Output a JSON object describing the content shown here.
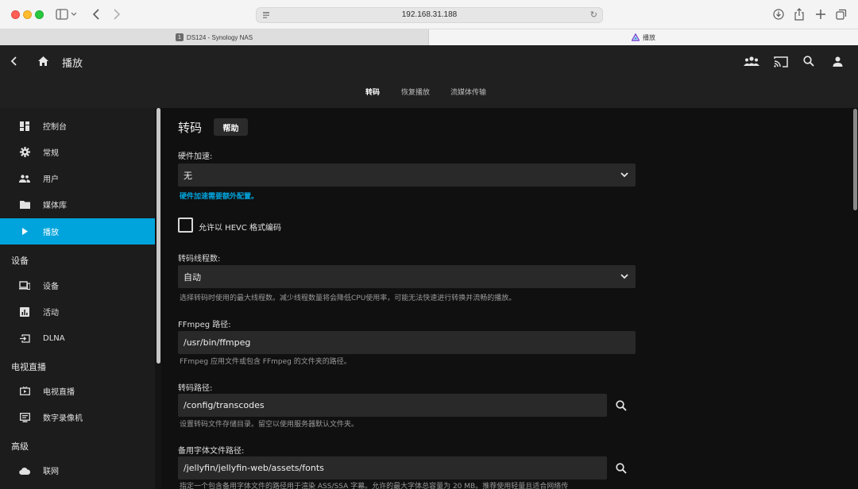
{
  "browser": {
    "url": "192.168.31.188",
    "tabs": [
      {
        "label": "DS124 - Synology NAS",
        "badge": "1"
      },
      {
        "label": "播放"
      }
    ]
  },
  "header": {
    "title": "播放",
    "subtabs": [
      {
        "label": "转码",
        "active": true
      },
      {
        "label": "恢复播放",
        "active": false
      },
      {
        "label": "流媒体传输",
        "active": false
      }
    ]
  },
  "sidebar": {
    "items_top": [
      {
        "label": "控制台",
        "icon": "dashboard-icon"
      },
      {
        "label": "常规",
        "icon": "gear-icon"
      },
      {
        "label": "用户",
        "icon": "users-icon"
      },
      {
        "label": "媒体库",
        "icon": "folder-icon"
      },
      {
        "label": "播放",
        "icon": "play-icon",
        "active": true
      }
    ],
    "section_devices": "设备",
    "items_devices": [
      {
        "label": "设备",
        "icon": "devices-icon"
      },
      {
        "label": "活动",
        "icon": "activity-icon"
      },
      {
        "label": "DLNA",
        "icon": "input-icon"
      }
    ],
    "section_livetv": "电视直播",
    "items_livetv": [
      {
        "label": "电视直播",
        "icon": "tv-icon"
      },
      {
        "label": "数字录像机",
        "icon": "dvr-icon"
      }
    ],
    "section_advanced": "高级",
    "items_advanced": [
      {
        "label": "联网",
        "icon": "cloud-icon"
      }
    ]
  },
  "main": {
    "title": "转码",
    "help_label": "帮助",
    "hw_accel": {
      "label": "硬件加速:",
      "value": "无",
      "link": "硬件加速需要额外配置。"
    },
    "hevc_checkbox": {
      "label": "允许以 HEVC 格式编码",
      "checked": false
    },
    "threads": {
      "label": "转码线程数:",
      "value": "自动",
      "hint": "选择转码时使用的最大线程数。减少线程数量将会降低CPU使用率，可能无法快速进行转换并流畅的播放。"
    },
    "ffmpeg": {
      "label": "FFmpeg 路径:",
      "value": "/usr/bin/ffmpeg",
      "hint": "FFmpeg 应用文件或包含 FFmpeg 的文件夹的路径。"
    },
    "transcode_path": {
      "label": "转码路径:",
      "value": "/config/transcodes",
      "hint": "设置转码文件存储目录。留空以使用服务器默认文件夹。"
    },
    "fonts_path": {
      "label": "备用字体文件路径:",
      "value": "/jellyfin/jellyfin-web/assets/fonts",
      "hint": "指定一个包含备用字体文件的路径用于渲染 ASS/SSA 字幕。允许的最大字体总容量为 20 MB。推荐使用轻量且适合网络传"
    }
  },
  "colors": {
    "accent": "#00a4dc",
    "header_bg": "#202020",
    "sidebar_bg": "#1c1c1c",
    "content_bg": "#101010",
    "field_bg": "#292929"
  }
}
